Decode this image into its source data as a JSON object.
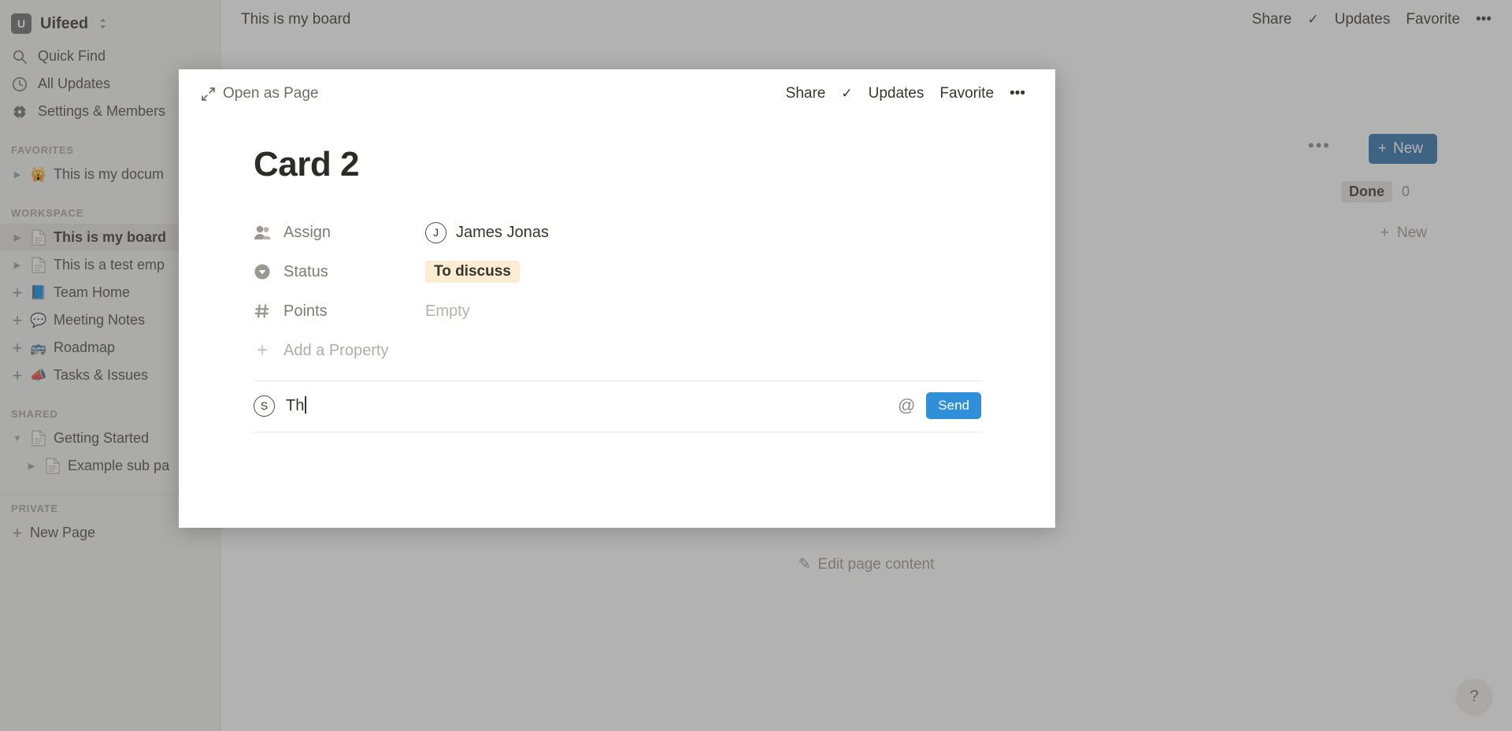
{
  "sidebar": {
    "workspace": {
      "logo_letter": "U",
      "name": "Uifeed",
      "switch_icon": "chevron-updown-icon"
    },
    "nav": [
      {
        "icon": "search-icon",
        "label": "Quick Find"
      },
      {
        "icon": "clock-icon",
        "label": "All Updates"
      },
      {
        "icon": "gear-icon",
        "label": "Settings & Members"
      }
    ],
    "sections": [
      {
        "label": "FAVORITES",
        "items": [
          {
            "twisty": "collapsed",
            "emoji": "🙀",
            "label": "This is my docum",
            "active": false,
            "indent": false
          }
        ]
      },
      {
        "label": "WORKSPACE",
        "items": [
          {
            "twisty": "collapsed",
            "emoji": "",
            "label": "This is my board",
            "active": true,
            "indent": false
          },
          {
            "twisty": "collapsed",
            "emoji": "",
            "label": "This is a test emp",
            "active": false,
            "indent": false
          },
          {
            "twisty": "plus",
            "emoji": "📘",
            "label": "Team Home",
            "active": false,
            "indent": false
          },
          {
            "twisty": "plus",
            "emoji": "💬",
            "label": "Meeting Notes",
            "active": false,
            "indent": false
          },
          {
            "twisty": "plus",
            "emoji": "🚌",
            "label": "Roadmap",
            "active": false,
            "indent": false
          },
          {
            "twisty": "plus",
            "emoji": "📣",
            "label": "Tasks & Issues",
            "active": false,
            "indent": false
          }
        ]
      },
      {
        "label": "SHARED",
        "items": [
          {
            "twisty": "expanded",
            "emoji": "",
            "label": "Getting Started",
            "active": false,
            "indent": false
          },
          {
            "twisty": "collapsed",
            "emoji": "",
            "label": "Example sub pa",
            "active": false,
            "indent": true
          }
        ]
      },
      {
        "label": "PRIVATE",
        "items": [
          {
            "twisty": "plus",
            "emoji": "",
            "label": "New Page",
            "active": false,
            "indent": false
          }
        ]
      }
    ]
  },
  "board": {
    "title": "This is my board",
    "actions": {
      "share": "Share",
      "updates": "Updates",
      "favorite": "Favorite",
      "more": "•••"
    },
    "new_button": "New",
    "column": {
      "name": "Done",
      "count": "0"
    },
    "new_row": "New",
    "edit_page_content": "Edit page content",
    "help": "?"
  },
  "modal": {
    "open_as_page": "Open as Page",
    "actions": {
      "share": "Share",
      "updates": "Updates",
      "favorite": "Favorite",
      "more": "•••"
    },
    "card_title": "Card 2",
    "properties": [
      {
        "icon": "people-icon",
        "name": "Assign",
        "value_type": "person",
        "avatar_letter": "J",
        "value": "James Jonas"
      },
      {
        "icon": "status-circle-icon",
        "name": "Status",
        "value_type": "chip",
        "value": "To discuss"
      },
      {
        "icon": "hash-icon",
        "name": "Points",
        "value_type": "empty",
        "value": "Empty"
      }
    ],
    "add_property": "Add a Property",
    "comment": {
      "avatar_letter": "S",
      "text": "Th",
      "mention_icon": "at-icon",
      "send_label": "Send"
    }
  },
  "colors": {
    "accent_blue": "#2f8fd8",
    "board_new_blue": "#2f6fa8",
    "status_chip_bg": "#fbecd2",
    "sidebar_bg": "#f3f2f0"
  }
}
